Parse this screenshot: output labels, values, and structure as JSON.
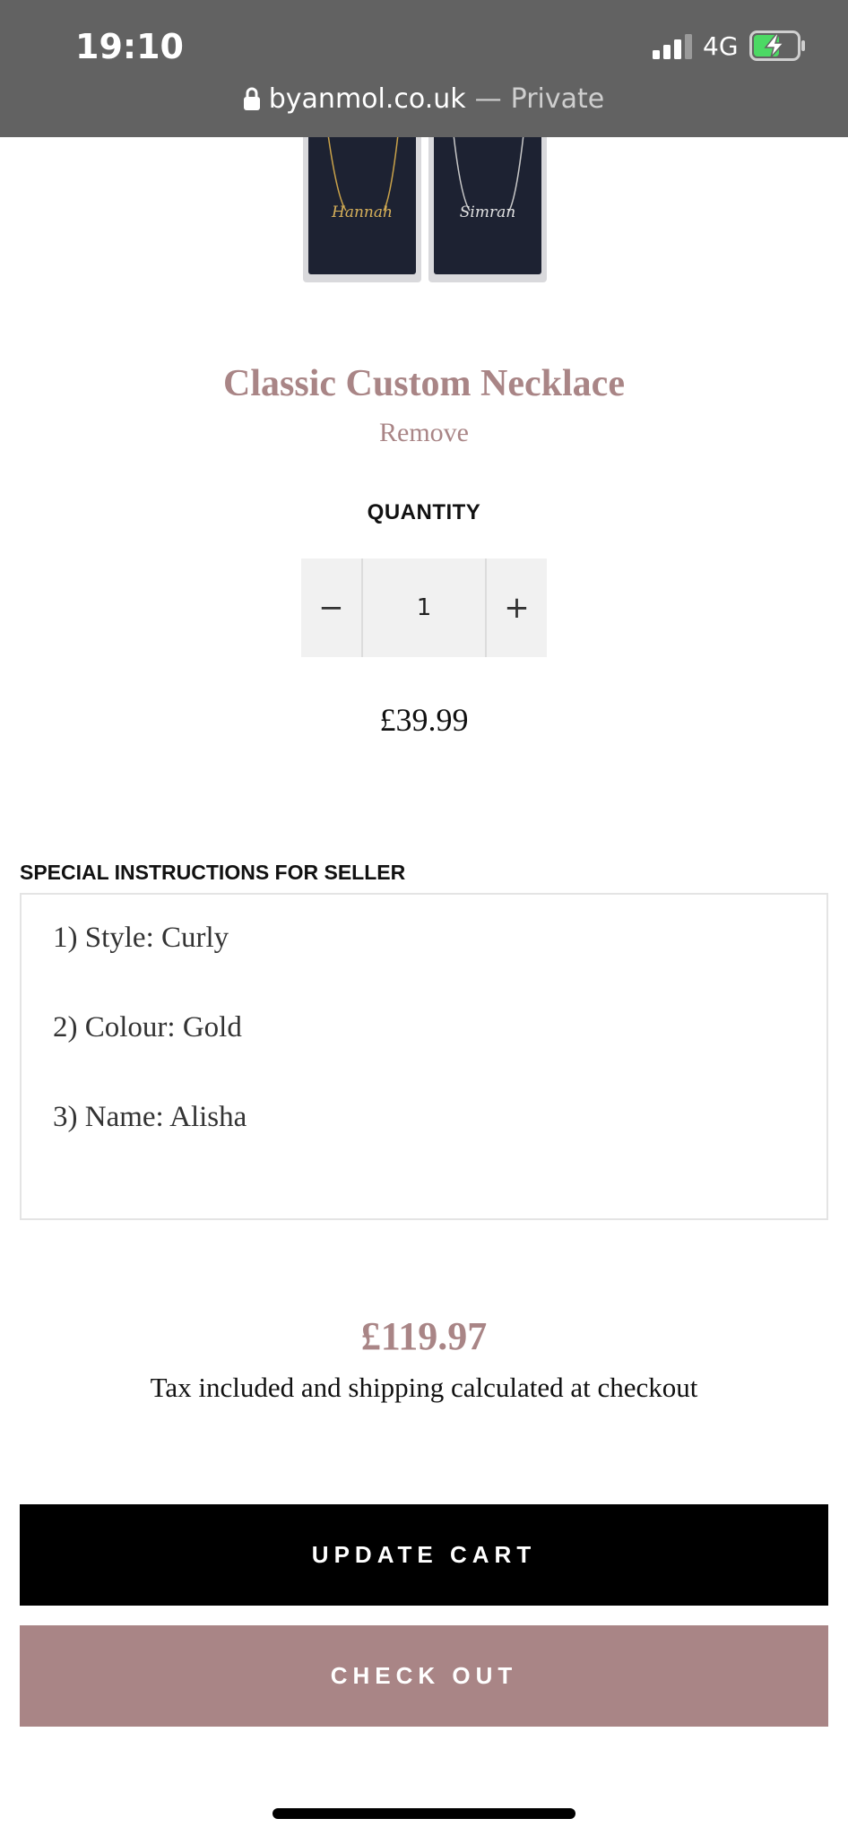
{
  "status_bar": {
    "time": "19:10",
    "network": "4G",
    "icons": [
      "signal-icon",
      "battery-charging-icon"
    ]
  },
  "url_bar": {
    "host": "byanmol.co.uk",
    "separator": "—",
    "mode": "Private",
    "icon": "lock-icon"
  },
  "product": {
    "image_names": [
      "Hannah",
      "Simran"
    ],
    "title": "Classic Custom Necklace",
    "remove_label": "Remove",
    "quantity_label": "QUANTITY",
    "quantity": "1",
    "decrement_symbol": "−",
    "increment_symbol": "+",
    "price": "£39.99"
  },
  "instructions": {
    "label": "SPECIAL INSTRUCTIONS FOR SELLER",
    "lines": [
      "1)  Style: Curly",
      "2) Colour: Gold",
      "3)  Name: Alisha"
    ]
  },
  "summary": {
    "subtotal": "£119.97",
    "tax_note": "Tax included and shipping calculated at checkout"
  },
  "actions": {
    "update_label": "UPDATE CART",
    "checkout_label": "CHECK OUT"
  },
  "colors": {
    "accent": "#a98586",
    "topbar": "#626262",
    "primary_button": "#000000",
    "battery_charge": "#4cd964"
  }
}
